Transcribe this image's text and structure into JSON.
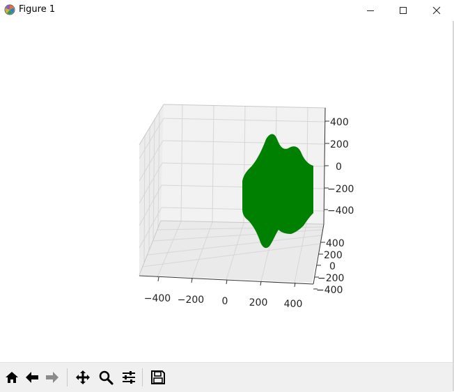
{
  "window": {
    "title": "Figure 1",
    "controls": [
      "minimize-icon",
      "maximize-icon",
      "close-icon"
    ]
  },
  "plot": {
    "surface_color": "#008000",
    "pane_color": "#f2f2f2",
    "grid_color": "#d9d9d9",
    "x_ticks": [
      "−400",
      "−200",
      "0",
      "200",
      "400"
    ],
    "y_ticks": [
      "400",
      "200",
      "0",
      "−200",
      "−400"
    ],
    "z_ticks": [
      "400",
      "200",
      "0",
      "−200",
      "−400"
    ]
  },
  "toolbar": {
    "buttons": [
      "home-icon",
      "back-arrow-icon",
      "forward-arrow-icon",
      "pan-icon",
      "zoom-icon",
      "configure-subplots-icon",
      "save-icon"
    ]
  }
}
